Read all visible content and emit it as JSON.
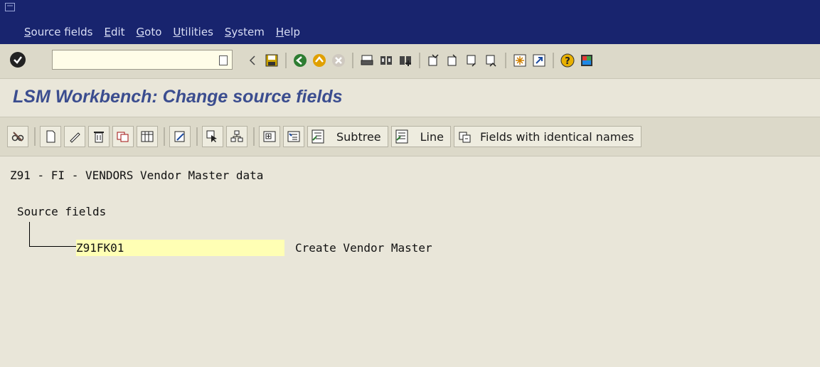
{
  "menu": [
    "Source fields",
    "Edit",
    "Goto",
    "Utilities",
    "System",
    "Help"
  ],
  "command_field": {
    "value": ""
  },
  "page_title": "LSM Workbench: Change source fields",
  "app_toolbar": {
    "subtree_label": "Subtree",
    "line_label": "Line",
    "identical_names_label": "Fields with identical names"
  },
  "content": {
    "header_line": "Z91 - FI - VENDORS Vendor Master data",
    "tree_root": "Source fields",
    "node": {
      "name": "Z91FK01",
      "description": "Create Vendor Master"
    }
  },
  "colors": {
    "title_bar": "#18246e",
    "background": "#e9e6d9",
    "title_text": "#3b4d8f",
    "highlight": "#ffffb4"
  }
}
